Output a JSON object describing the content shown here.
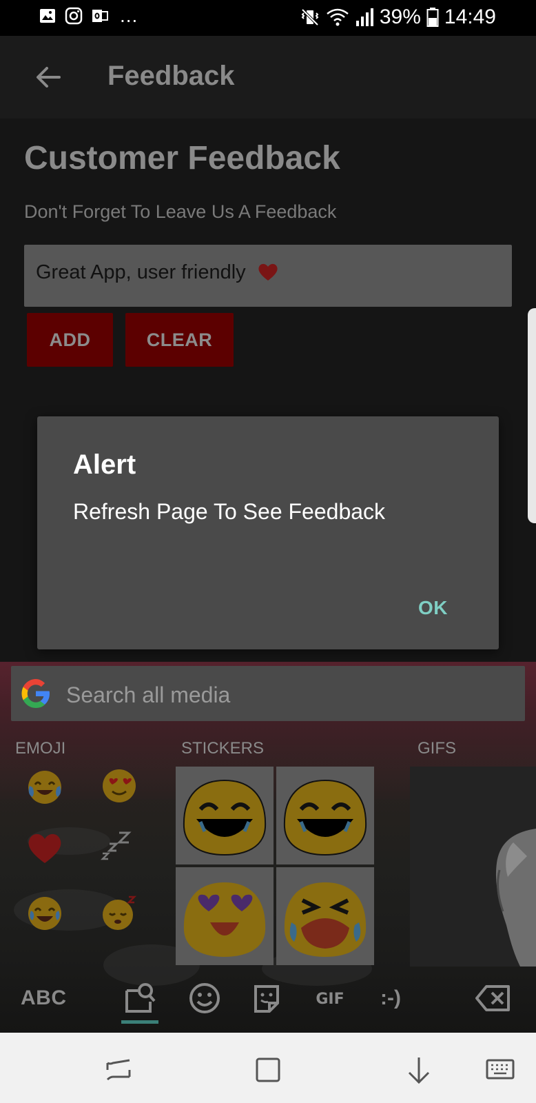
{
  "status_bar": {
    "left_icons": [
      "image-icon",
      "instagram-icon",
      "outlook-icon"
    ],
    "overflow": "...",
    "right_icons": [
      "vibrate-mute-icon",
      "wifi-icon",
      "signal-icon"
    ],
    "battery_percent": "39%",
    "time": "14:49"
  },
  "toolbar": {
    "title": "Feedback",
    "back_icon": "back-arrow-icon"
  },
  "page": {
    "title": "Customer Feedback",
    "subtitle": "Don't Forget To Leave Us A Feedback",
    "feedback_input_value": "Great App, user friendly",
    "feedback_input_emoji": "heart-emoji",
    "add_label": "ADD",
    "clear_label": "CLEAR"
  },
  "dialog": {
    "title": "Alert",
    "message": "Refresh Page To See Feedback",
    "ok_label": "OK"
  },
  "keyboard": {
    "search_placeholder": "Search all media",
    "categories": {
      "emoji": "EMOJI",
      "stickers": "STICKERS",
      "gifs": "GIFS"
    },
    "emojis": [
      "tears-of-joy-crying",
      "heart-eyes",
      "red-heart",
      "sleeping-zzz",
      "tears-of-joy",
      "sleeping-face"
    ],
    "stickers": [
      "laughing-blob",
      "laughing-blob",
      "heart-eyes-blob",
      "crying-blob"
    ],
    "bottom_keys": {
      "abc": "ABC",
      "emoticon": ":-)"
    },
    "bottom_icons": [
      "sticker-search-icon",
      "smiley-icon",
      "sticker-icon",
      "gif-icon",
      "backspace-icon"
    ]
  },
  "nav_bar": {
    "icons": [
      "recents-icon",
      "home-icon",
      "hide-keyboard-icon",
      "keyboard-switch-icon"
    ]
  },
  "colors": {
    "accent_ok": "#7fcfc4",
    "button_red": "#5c0000",
    "dialog_bg": "#4a4a4a"
  }
}
